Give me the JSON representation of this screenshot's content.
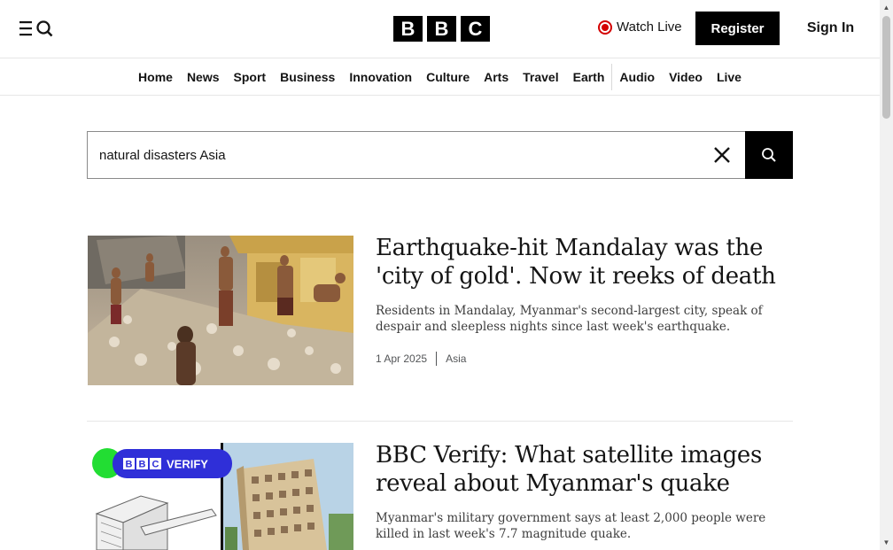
{
  "header": {
    "logo_letters": [
      "B",
      "B",
      "C"
    ],
    "watch_live": "Watch Live",
    "register": "Register",
    "sign_in": "Sign In"
  },
  "nav": {
    "items": [
      "Home",
      "News",
      "Sport",
      "Business",
      "Innovation",
      "Culture",
      "Arts",
      "Travel",
      "Earth",
      "Audio",
      "Video",
      "Live"
    ]
  },
  "search": {
    "value": "natural disasters Asia"
  },
  "results": [
    {
      "title": "Earthquake-hit Mandalay was the 'city of gold'. Now it reeks of death",
      "description": "Residents in Mandalay, Myanmar's second-largest city, speak of despair and sleepless nights since last week's earthquake.",
      "date": "1 Apr 2025",
      "section": "Asia"
    },
    {
      "title": "BBC Verify: What satellite images reveal about Myanmar's quake",
      "description": "Myanmar's military government says at least 2,000 people were killed in last week's 7.7 magnitude quake.",
      "badge_letters": [
        "B",
        "B",
        "C"
      ],
      "badge_label": "VERIFY"
    }
  ],
  "colors": {
    "live_red": "#d40000",
    "black": "#000000",
    "verify_blue": "#2f2fd8",
    "verify_green": "#22dd33"
  }
}
